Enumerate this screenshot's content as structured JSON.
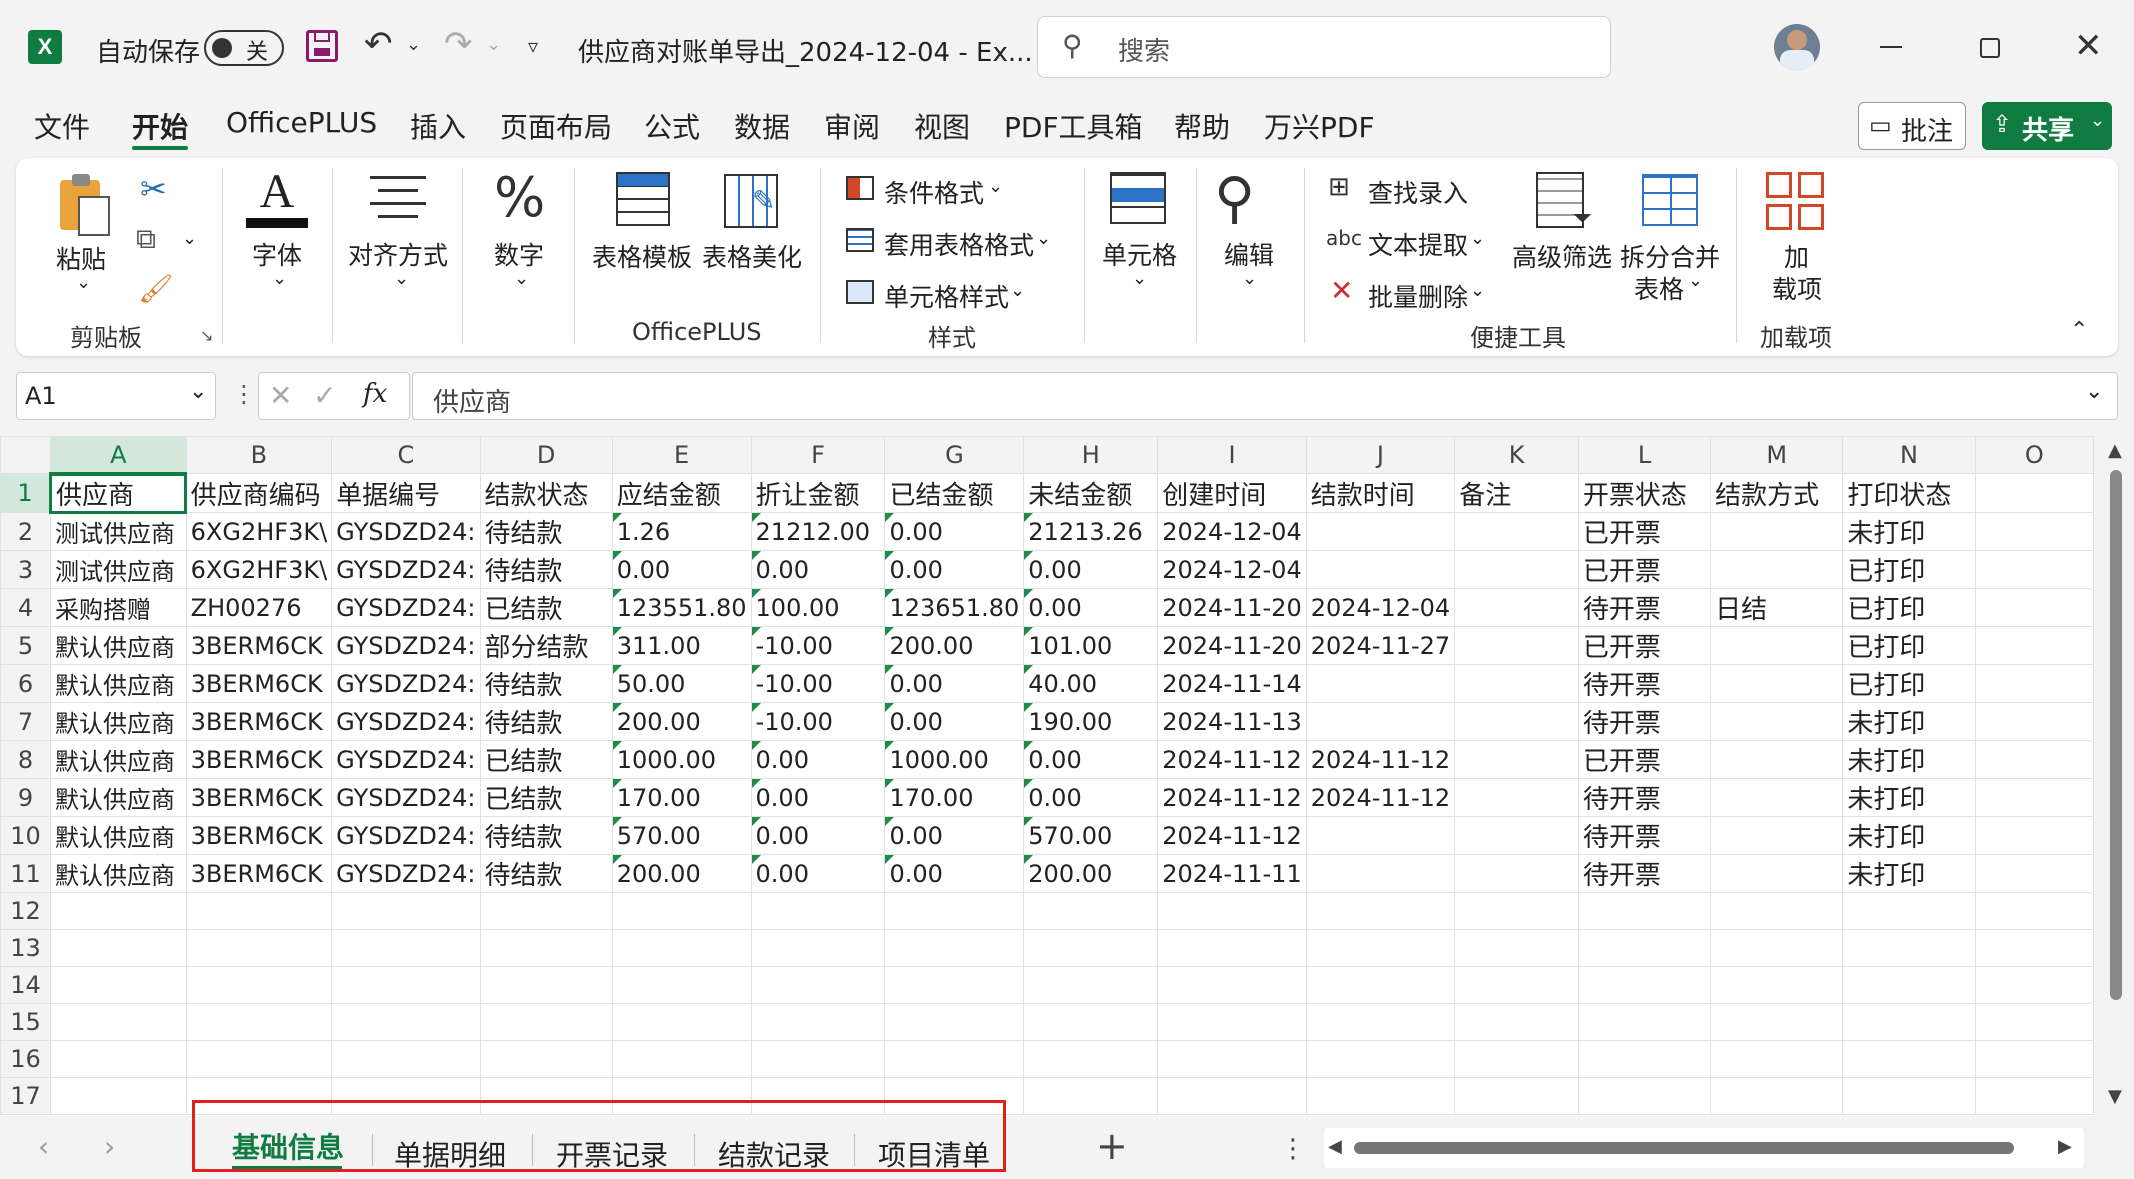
{
  "titlebar": {
    "autosave_label": "自动保存",
    "toggle_state": "关",
    "doc_title": "供应商对账单导出_2024-12-04  -  Ex...",
    "search_placeholder": "搜索"
  },
  "menu": {
    "items": [
      "文件",
      "开始",
      "OfficePLUS",
      "插入",
      "页面布局",
      "公式",
      "数据",
      "审阅",
      "视图",
      "PDF工具箱",
      "帮助",
      "万兴PDF"
    ],
    "active": "开始",
    "comment_button": "批注",
    "share_button": "共享"
  },
  "ribbon": {
    "paste": "粘贴",
    "clipboard_group": "剪贴板",
    "font": "字体",
    "alignment": "对齐方式",
    "number": "数字",
    "table_template": "表格模板",
    "table_beautify": "表格美化",
    "officeplus_group": "OfficePLUS",
    "conditional_format": "条件格式",
    "table_format": "套用表格格式",
    "cell_style": "单元格样式",
    "styles_group": "样式",
    "cells": "单元格",
    "edit": "编辑",
    "find_entry": "查找录入",
    "text_extract": "文本提取",
    "batch_delete": "批量删除",
    "advanced_filter": "高级筛选",
    "split_merge_1": "拆分合并",
    "split_merge_2": "表格",
    "quick_tools_group": "便捷工具",
    "addin_1": "加",
    "addin_2": "载项",
    "addins_group": "加载项"
  },
  "formula_bar": {
    "cell_ref": "A1",
    "fx": "fx",
    "content": "供应商"
  },
  "sheet": {
    "columns": [
      "A",
      "B",
      "C",
      "D",
      "E",
      "F",
      "G",
      "H",
      "I",
      "J",
      "K",
      "L",
      "M",
      "N",
      "O"
    ],
    "rows": [
      [
        "供应商",
        "供应商编码",
        "单据编号",
        "结款状态",
        "应结金额",
        "折让金额",
        "已结金额",
        "未结金额",
        "创建时间",
        "结款时间",
        "备注",
        "开票状态",
        "结款方式",
        "打印状态",
        ""
      ],
      [
        "测试供应商",
        "6XG2HF3K\\",
        "GYSDZD24:",
        "待结款",
        "1.26",
        "21212.00",
        "0.00",
        "21213.26",
        "2024-12-04",
        "",
        "",
        "已开票",
        "",
        "未打印",
        ""
      ],
      [
        "测试供应商",
        "6XG2HF3K\\",
        "GYSDZD24:",
        "待结款",
        "0.00",
        "0.00",
        "0.00",
        "0.00",
        "2024-12-04",
        "",
        "",
        "已开票",
        "",
        "已打印",
        ""
      ],
      [
        "采购搭赠",
        "ZH00276",
        "GYSDZD24:",
        "已结款",
        "123551.80",
        "100.00",
        "123651.80",
        "0.00",
        "2024-11-20",
        "2024-12-04",
        "",
        "待开票",
        "日结",
        "已打印",
        ""
      ],
      [
        "默认供应商",
        "3BERM6CK",
        "GYSDZD24:",
        "部分结款",
        "311.00",
        "-10.00",
        "200.00",
        "101.00",
        "2024-11-20",
        "2024-11-27",
        "",
        "已开票",
        "",
        "已打印",
        ""
      ],
      [
        "默认供应商",
        "3BERM6CK",
        "GYSDZD24:",
        "待结款",
        "50.00",
        "-10.00",
        "0.00",
        "40.00",
        "2024-11-14",
        "",
        "",
        "待开票",
        "",
        "已打印",
        ""
      ],
      [
        "默认供应商",
        "3BERM6CK",
        "GYSDZD24:",
        "待结款",
        "200.00",
        "-10.00",
        "0.00",
        "190.00",
        "2024-11-13",
        "",
        "",
        "待开票",
        "",
        "未打印",
        ""
      ],
      [
        "默认供应商",
        "3BERM6CK",
        "GYSDZD24:",
        "已结款",
        "1000.00",
        "0.00",
        "1000.00",
        "0.00",
        "2024-11-12",
        "2024-11-12",
        "",
        "已开票",
        "",
        "未打印",
        ""
      ],
      [
        "默认供应商",
        "3BERM6CK",
        "GYSDZD24:",
        "已结款",
        "170.00",
        "0.00",
        "170.00",
        "0.00",
        "2024-11-12",
        "2024-11-12",
        "",
        "待开票",
        "",
        "未打印",
        ""
      ],
      [
        "默认供应商",
        "3BERM6CK",
        "GYSDZD24:",
        "待结款",
        "570.00",
        "0.00",
        "0.00",
        "570.00",
        "2024-11-12",
        "",
        "",
        "待开票",
        "",
        "未打印",
        ""
      ],
      [
        "默认供应商",
        "3BERM6CK",
        "GYSDZD24:",
        "待结款",
        "200.00",
        "0.00",
        "0.00",
        "200.00",
        "2024-11-11",
        "",
        "",
        "待开票",
        "",
        "未打印",
        ""
      ],
      [
        "",
        "",
        "",
        "",
        "",
        "",
        "",
        "",
        "",
        "",
        "",
        "",
        "",
        "",
        ""
      ],
      [
        "",
        "",
        "",
        "",
        "",
        "",
        "",
        "",
        "",
        "",
        "",
        "",
        "",
        "",
        ""
      ],
      [
        "",
        "",
        "",
        "",
        "",
        "",
        "",
        "",
        "",
        "",
        "",
        "",
        "",
        "",
        ""
      ],
      [
        "",
        "",
        "",
        "",
        "",
        "",
        "",
        "",
        "",
        "",
        "",
        "",
        "",
        "",
        ""
      ],
      [
        "",
        "",
        "",
        "",
        "",
        "",
        "",
        "",
        "",
        "",
        "",
        "",
        "",
        "",
        ""
      ],
      [
        "",
        "",
        "",
        "",
        "",
        "",
        "",
        "",
        "",
        "",
        "",
        "",
        "",
        "",
        ""
      ]
    ]
  },
  "sheet_tabs": {
    "tabs": [
      "基础信息",
      "单据明细",
      "开票记录",
      "结款记录",
      "项目清单"
    ],
    "active": "基础信息",
    "add": "+"
  },
  "colors": {
    "accent": "#107c41",
    "highlight_box": "#e0201f"
  }
}
